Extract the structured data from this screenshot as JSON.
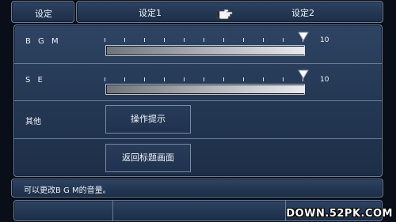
{
  "header": {
    "title": "设定",
    "tabs": [
      {
        "label": "设定1"
      },
      {
        "label": "设定2"
      }
    ],
    "cursor_icon": "pointing-hand-icon"
  },
  "settings": {
    "bgm": {
      "label": "B G M",
      "value": "10",
      "level": 1.0
    },
    "se": {
      "label": "S E",
      "value": "10",
      "level": 1.0
    },
    "other": {
      "label": "其他",
      "buttons": [
        {
          "label": "操作提示"
        },
        {
          "label": "返回标题画面"
        }
      ]
    }
  },
  "help": {
    "text": "可以更改B G M的音量。"
  },
  "watermark": "DOWN.52PK.COM",
  "colors": {
    "panel": "#243854",
    "border": "#6c7e99",
    "thumb": "#ffffff"
  }
}
